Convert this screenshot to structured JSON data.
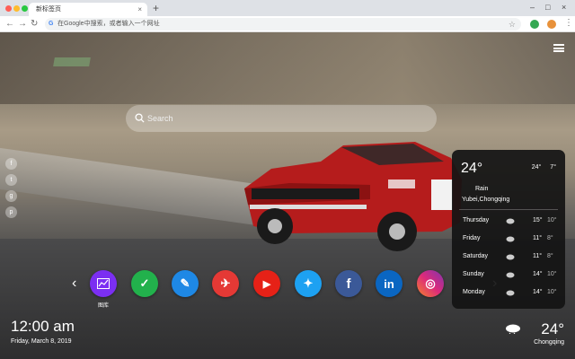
{
  "browser": {
    "tab_title": "新标签页",
    "tab_close": "×",
    "new_tab": "+",
    "window_controls": [
      "–",
      "□",
      "×"
    ],
    "address_placeholder": "在Google中搜索，或者输入一个网址",
    "google_mark": "G",
    "colors": {
      "traffic_red": "#ff5f57",
      "traffic_yellow": "#febc2e",
      "traffic_green": "#28c840",
      "ext_green": "#34a853",
      "ext_orange": "#e8913a"
    }
  },
  "search": {
    "placeholder": "Search"
  },
  "side_social": [
    "f",
    "t",
    "g",
    "p"
  ],
  "dock": {
    "prev": "‹",
    "next": "›",
    "apps": [
      {
        "icon": "chart-icon",
        "color": "#7b2ff2",
        "glyph": "📈"
      },
      {
        "icon": "check-icon",
        "color": "#22b14c",
        "glyph": "✓"
      },
      {
        "icon": "note-icon",
        "color": "#1e88e5",
        "glyph": "✎"
      },
      {
        "icon": "game-icon",
        "color": "#e53935",
        "glyph": "✈"
      },
      {
        "icon": "youtube-icon",
        "color": "#e62117",
        "glyph": "▶"
      },
      {
        "icon": "twitter-icon",
        "color": "#1da1f2",
        "glyph": "✦"
      },
      {
        "icon": "facebook-icon",
        "color": "#3b5998",
        "glyph": "f"
      },
      {
        "icon": "linkedin-icon",
        "color": "#0a66c2",
        "glyph": "in"
      },
      {
        "icon": "instagram-icon",
        "color": "#c13584",
        "glyph": "◎"
      }
    ],
    "first_label": "图库"
  },
  "clock": {
    "time": "12:00 am",
    "date": "Friday, March 8, 2019"
  },
  "weather_mini": {
    "temp": "24°",
    "city": "Chongqing"
  },
  "weather_panel": {
    "temp": "24°",
    "high": "24°",
    "low": "7°",
    "condition": "Rain",
    "location": "Yubei,Chongqing",
    "forecast": [
      {
        "day": "Thursday",
        "high": "15°",
        "low": "10°"
      },
      {
        "day": "Friday",
        "high": "11°",
        "low": "8°"
      },
      {
        "day": "Saturday",
        "high": "11°",
        "low": "8°"
      },
      {
        "day": "Sunday",
        "high": "14°",
        "low": "10°"
      },
      {
        "day": "Monday",
        "high": "14°",
        "low": "10°"
      }
    ]
  }
}
